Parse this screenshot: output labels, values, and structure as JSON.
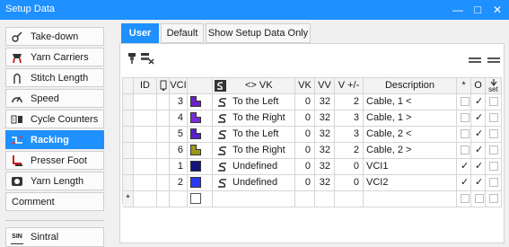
{
  "window": {
    "title": "Setup Data",
    "minimize_glyph": "—",
    "maximize_glyph": "□",
    "close_glyph": "✕"
  },
  "sidebar": {
    "items": [
      {
        "label": "Take-down",
        "icon": "take-down-icon"
      },
      {
        "label": "Yarn Carriers",
        "icon": "yarn-carriers-icon"
      },
      {
        "label": "Stitch Length",
        "icon": "stitch-length-icon"
      },
      {
        "label": "Speed",
        "icon": "speed-icon"
      },
      {
        "label": "Cycle Counters",
        "icon": "cycle-counters-icon"
      },
      {
        "label": "Racking",
        "icon": "racking-icon",
        "active": true
      },
      {
        "label": "Presser Foot",
        "icon": "presser-foot-icon"
      },
      {
        "label": "Yarn Length",
        "icon": "yarn-length-icon"
      },
      {
        "label": "Comment"
      }
    ],
    "sintral": {
      "label": "Sintral",
      "icon_text": "SIN"
    }
  },
  "tabs": [
    {
      "label": "User",
      "active": true
    },
    {
      "label": "Default"
    },
    {
      "label": "Show Setup Data Only"
    }
  ],
  "table": {
    "headers": {
      "id": "ID",
      "vci": "VCI",
      "vk": "<> VK",
      "vk_num": "VK",
      "vv": "VV",
      "vpm": "V +/-",
      "description": "Description",
      "star": "*",
      "o": "O",
      "set": "set"
    },
    "rows": [
      {
        "vci": "3",
        "color": "#6a1fc8",
        "vk": "To the Left",
        "vk_num": "0",
        "vv": "32",
        "vpm": "2",
        "description": "Cable, 1 <",
        "star": "",
        "o": "✓"
      },
      {
        "vci": "4",
        "color": "#7b2bd6",
        "vk": "To the Right",
        "vk_num": "0",
        "vv": "32",
        "vpm": "3",
        "description": "Cable, 1 >",
        "star": "",
        "o": "✓"
      },
      {
        "vci": "5",
        "color": "#5a22c4",
        "vk": "To the Left",
        "vk_num": "0",
        "vv": "32",
        "vpm": "3",
        "description": "Cable, 2 <",
        "star": "",
        "o": "✓"
      },
      {
        "vci": "6",
        "color": "#9a9a1a",
        "vk": "To the Right",
        "vk_num": "0",
        "vv": "32",
        "vpm": "2",
        "description": "Cable, 2 >",
        "star": "",
        "o": "✓"
      },
      {
        "vci": "1",
        "color": "#14147a",
        "vk": "Undefined",
        "vk_num": "0",
        "vv": "32",
        "vpm": "0",
        "description": "VCI1",
        "star": "✓",
        "o": "✓"
      },
      {
        "vci": "2",
        "color": "#2a3af0",
        "vk": "Undefined",
        "vk_num": "0",
        "vv": "32",
        "vpm": "0",
        "description": "VCI2",
        "star": "✓",
        "o": "✓"
      }
    ],
    "new_row_marker": "*"
  }
}
